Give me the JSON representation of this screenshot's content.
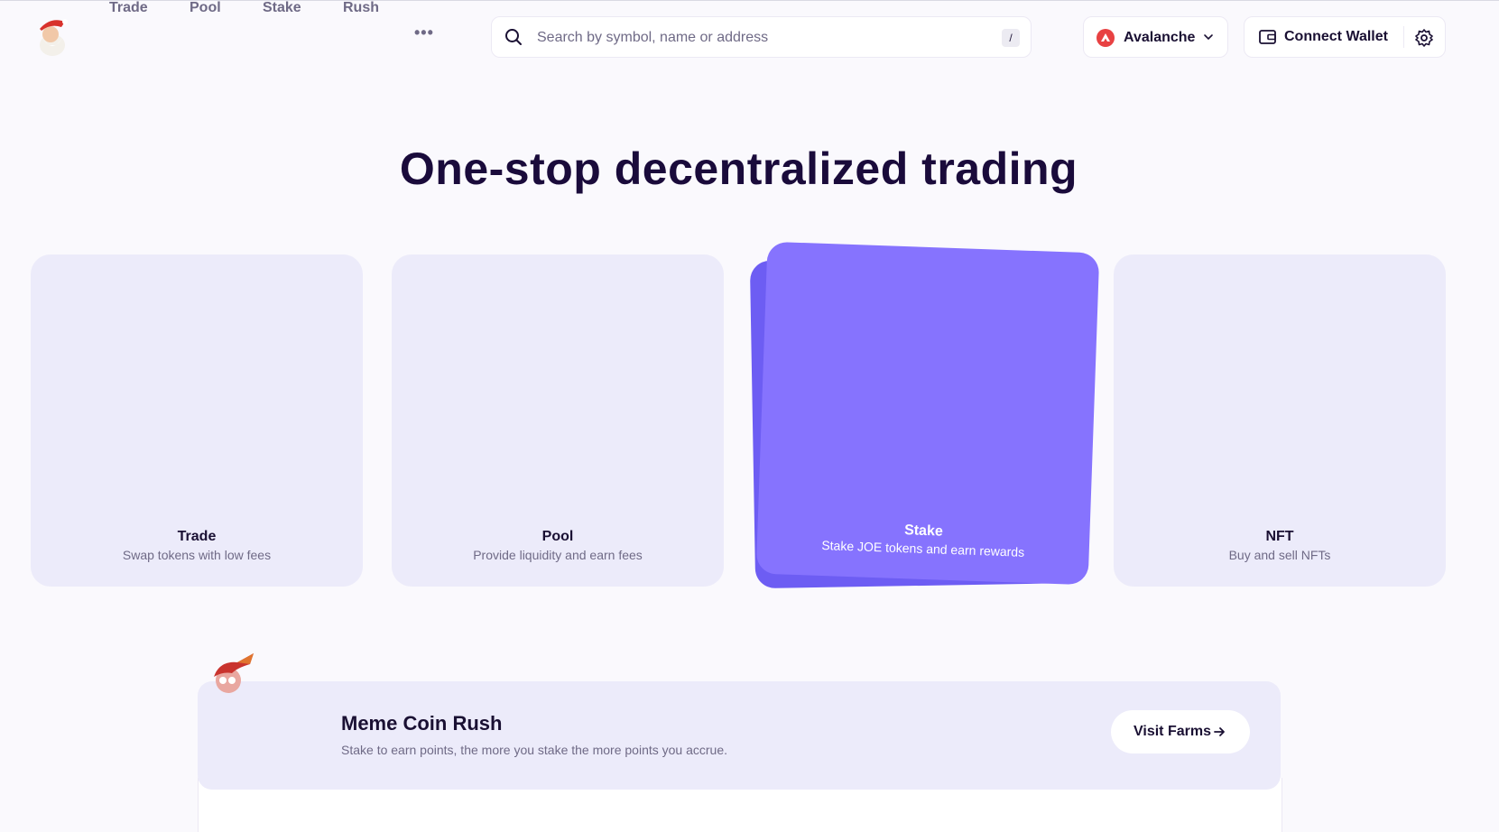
{
  "nav": {
    "items": [
      {
        "label": "Trade"
      },
      {
        "label": "Pool"
      },
      {
        "label": "Stake"
      },
      {
        "label": "Rush"
      }
    ],
    "more_icon": "more-dots-icon"
  },
  "search": {
    "placeholder": "Search by symbol, name or address",
    "shortcut": "/"
  },
  "chain": {
    "label": "Avalanche",
    "icon": "avalanche-icon",
    "color": "#e84142"
  },
  "wallet": {
    "label": "Connect Wallet"
  },
  "hero": {
    "title": "One-stop decentralized trading"
  },
  "cards": [
    {
      "title": "Trade",
      "subtitle": "Swap tokens with low fees"
    },
    {
      "title": "Pool",
      "subtitle": "Provide liquidity and earn fees"
    },
    {
      "title": "Stake",
      "subtitle": "Stake JOE tokens and earn rewards"
    },
    {
      "title": "NFT",
      "subtitle": "Buy and sell NFTs"
    }
  ],
  "rush": {
    "title": "Meme Coin Rush",
    "subtitle": "Stake to earn points, the more you stake the more points you accrue.",
    "button_label": "Visit Farms"
  },
  "colors": {
    "accent": "#8673fe",
    "card_bg": "#ecebfa",
    "title": "#1a0b3b"
  }
}
